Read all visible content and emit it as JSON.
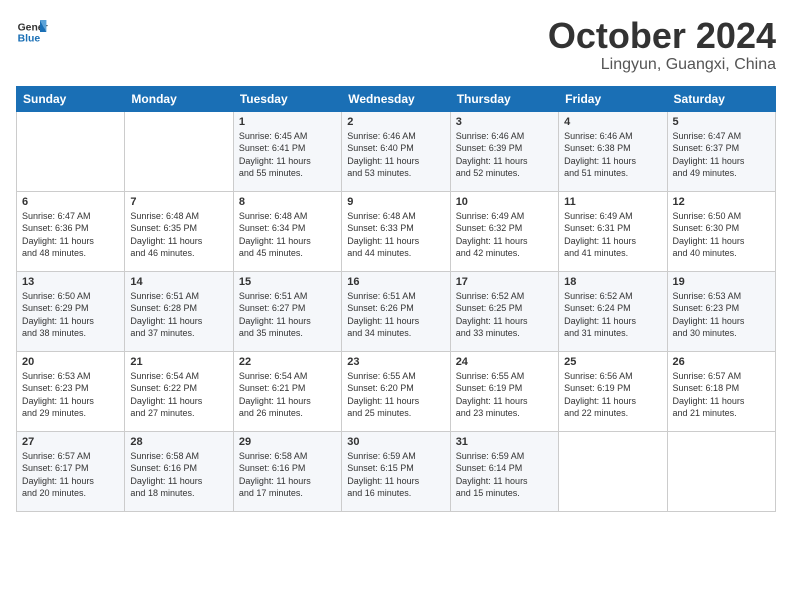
{
  "header": {
    "logo_general": "General",
    "logo_blue": "Blue",
    "month": "October 2024",
    "location": "Lingyun, Guangxi, China"
  },
  "days_of_week": [
    "Sunday",
    "Monday",
    "Tuesday",
    "Wednesday",
    "Thursday",
    "Friday",
    "Saturday"
  ],
  "weeks": [
    [
      {
        "day": "",
        "info": ""
      },
      {
        "day": "",
        "info": ""
      },
      {
        "day": "1",
        "info": "Sunrise: 6:45 AM\nSunset: 6:41 PM\nDaylight: 11 hours\nand 55 minutes."
      },
      {
        "day": "2",
        "info": "Sunrise: 6:46 AM\nSunset: 6:40 PM\nDaylight: 11 hours\nand 53 minutes."
      },
      {
        "day": "3",
        "info": "Sunrise: 6:46 AM\nSunset: 6:39 PM\nDaylight: 11 hours\nand 52 minutes."
      },
      {
        "day": "4",
        "info": "Sunrise: 6:46 AM\nSunset: 6:38 PM\nDaylight: 11 hours\nand 51 minutes."
      },
      {
        "day": "5",
        "info": "Sunrise: 6:47 AM\nSunset: 6:37 PM\nDaylight: 11 hours\nand 49 minutes."
      }
    ],
    [
      {
        "day": "6",
        "info": "Sunrise: 6:47 AM\nSunset: 6:36 PM\nDaylight: 11 hours\nand 48 minutes."
      },
      {
        "day": "7",
        "info": "Sunrise: 6:48 AM\nSunset: 6:35 PM\nDaylight: 11 hours\nand 46 minutes."
      },
      {
        "day": "8",
        "info": "Sunrise: 6:48 AM\nSunset: 6:34 PM\nDaylight: 11 hours\nand 45 minutes."
      },
      {
        "day": "9",
        "info": "Sunrise: 6:48 AM\nSunset: 6:33 PM\nDaylight: 11 hours\nand 44 minutes."
      },
      {
        "day": "10",
        "info": "Sunrise: 6:49 AM\nSunset: 6:32 PM\nDaylight: 11 hours\nand 42 minutes."
      },
      {
        "day": "11",
        "info": "Sunrise: 6:49 AM\nSunset: 6:31 PM\nDaylight: 11 hours\nand 41 minutes."
      },
      {
        "day": "12",
        "info": "Sunrise: 6:50 AM\nSunset: 6:30 PM\nDaylight: 11 hours\nand 40 minutes."
      }
    ],
    [
      {
        "day": "13",
        "info": "Sunrise: 6:50 AM\nSunset: 6:29 PM\nDaylight: 11 hours\nand 38 minutes."
      },
      {
        "day": "14",
        "info": "Sunrise: 6:51 AM\nSunset: 6:28 PM\nDaylight: 11 hours\nand 37 minutes."
      },
      {
        "day": "15",
        "info": "Sunrise: 6:51 AM\nSunset: 6:27 PM\nDaylight: 11 hours\nand 35 minutes."
      },
      {
        "day": "16",
        "info": "Sunrise: 6:51 AM\nSunset: 6:26 PM\nDaylight: 11 hours\nand 34 minutes."
      },
      {
        "day": "17",
        "info": "Sunrise: 6:52 AM\nSunset: 6:25 PM\nDaylight: 11 hours\nand 33 minutes."
      },
      {
        "day": "18",
        "info": "Sunrise: 6:52 AM\nSunset: 6:24 PM\nDaylight: 11 hours\nand 31 minutes."
      },
      {
        "day": "19",
        "info": "Sunrise: 6:53 AM\nSunset: 6:23 PM\nDaylight: 11 hours\nand 30 minutes."
      }
    ],
    [
      {
        "day": "20",
        "info": "Sunrise: 6:53 AM\nSunset: 6:23 PM\nDaylight: 11 hours\nand 29 minutes."
      },
      {
        "day": "21",
        "info": "Sunrise: 6:54 AM\nSunset: 6:22 PM\nDaylight: 11 hours\nand 27 minutes."
      },
      {
        "day": "22",
        "info": "Sunrise: 6:54 AM\nSunset: 6:21 PM\nDaylight: 11 hours\nand 26 minutes."
      },
      {
        "day": "23",
        "info": "Sunrise: 6:55 AM\nSunset: 6:20 PM\nDaylight: 11 hours\nand 25 minutes."
      },
      {
        "day": "24",
        "info": "Sunrise: 6:55 AM\nSunset: 6:19 PM\nDaylight: 11 hours\nand 23 minutes."
      },
      {
        "day": "25",
        "info": "Sunrise: 6:56 AM\nSunset: 6:19 PM\nDaylight: 11 hours\nand 22 minutes."
      },
      {
        "day": "26",
        "info": "Sunrise: 6:57 AM\nSunset: 6:18 PM\nDaylight: 11 hours\nand 21 minutes."
      }
    ],
    [
      {
        "day": "27",
        "info": "Sunrise: 6:57 AM\nSunset: 6:17 PM\nDaylight: 11 hours\nand 20 minutes."
      },
      {
        "day": "28",
        "info": "Sunrise: 6:58 AM\nSunset: 6:16 PM\nDaylight: 11 hours\nand 18 minutes."
      },
      {
        "day": "29",
        "info": "Sunrise: 6:58 AM\nSunset: 6:16 PM\nDaylight: 11 hours\nand 17 minutes."
      },
      {
        "day": "30",
        "info": "Sunrise: 6:59 AM\nSunset: 6:15 PM\nDaylight: 11 hours\nand 16 minutes."
      },
      {
        "day": "31",
        "info": "Sunrise: 6:59 AM\nSunset: 6:14 PM\nDaylight: 11 hours\nand 15 minutes."
      },
      {
        "day": "",
        "info": ""
      },
      {
        "day": "",
        "info": ""
      }
    ]
  ]
}
